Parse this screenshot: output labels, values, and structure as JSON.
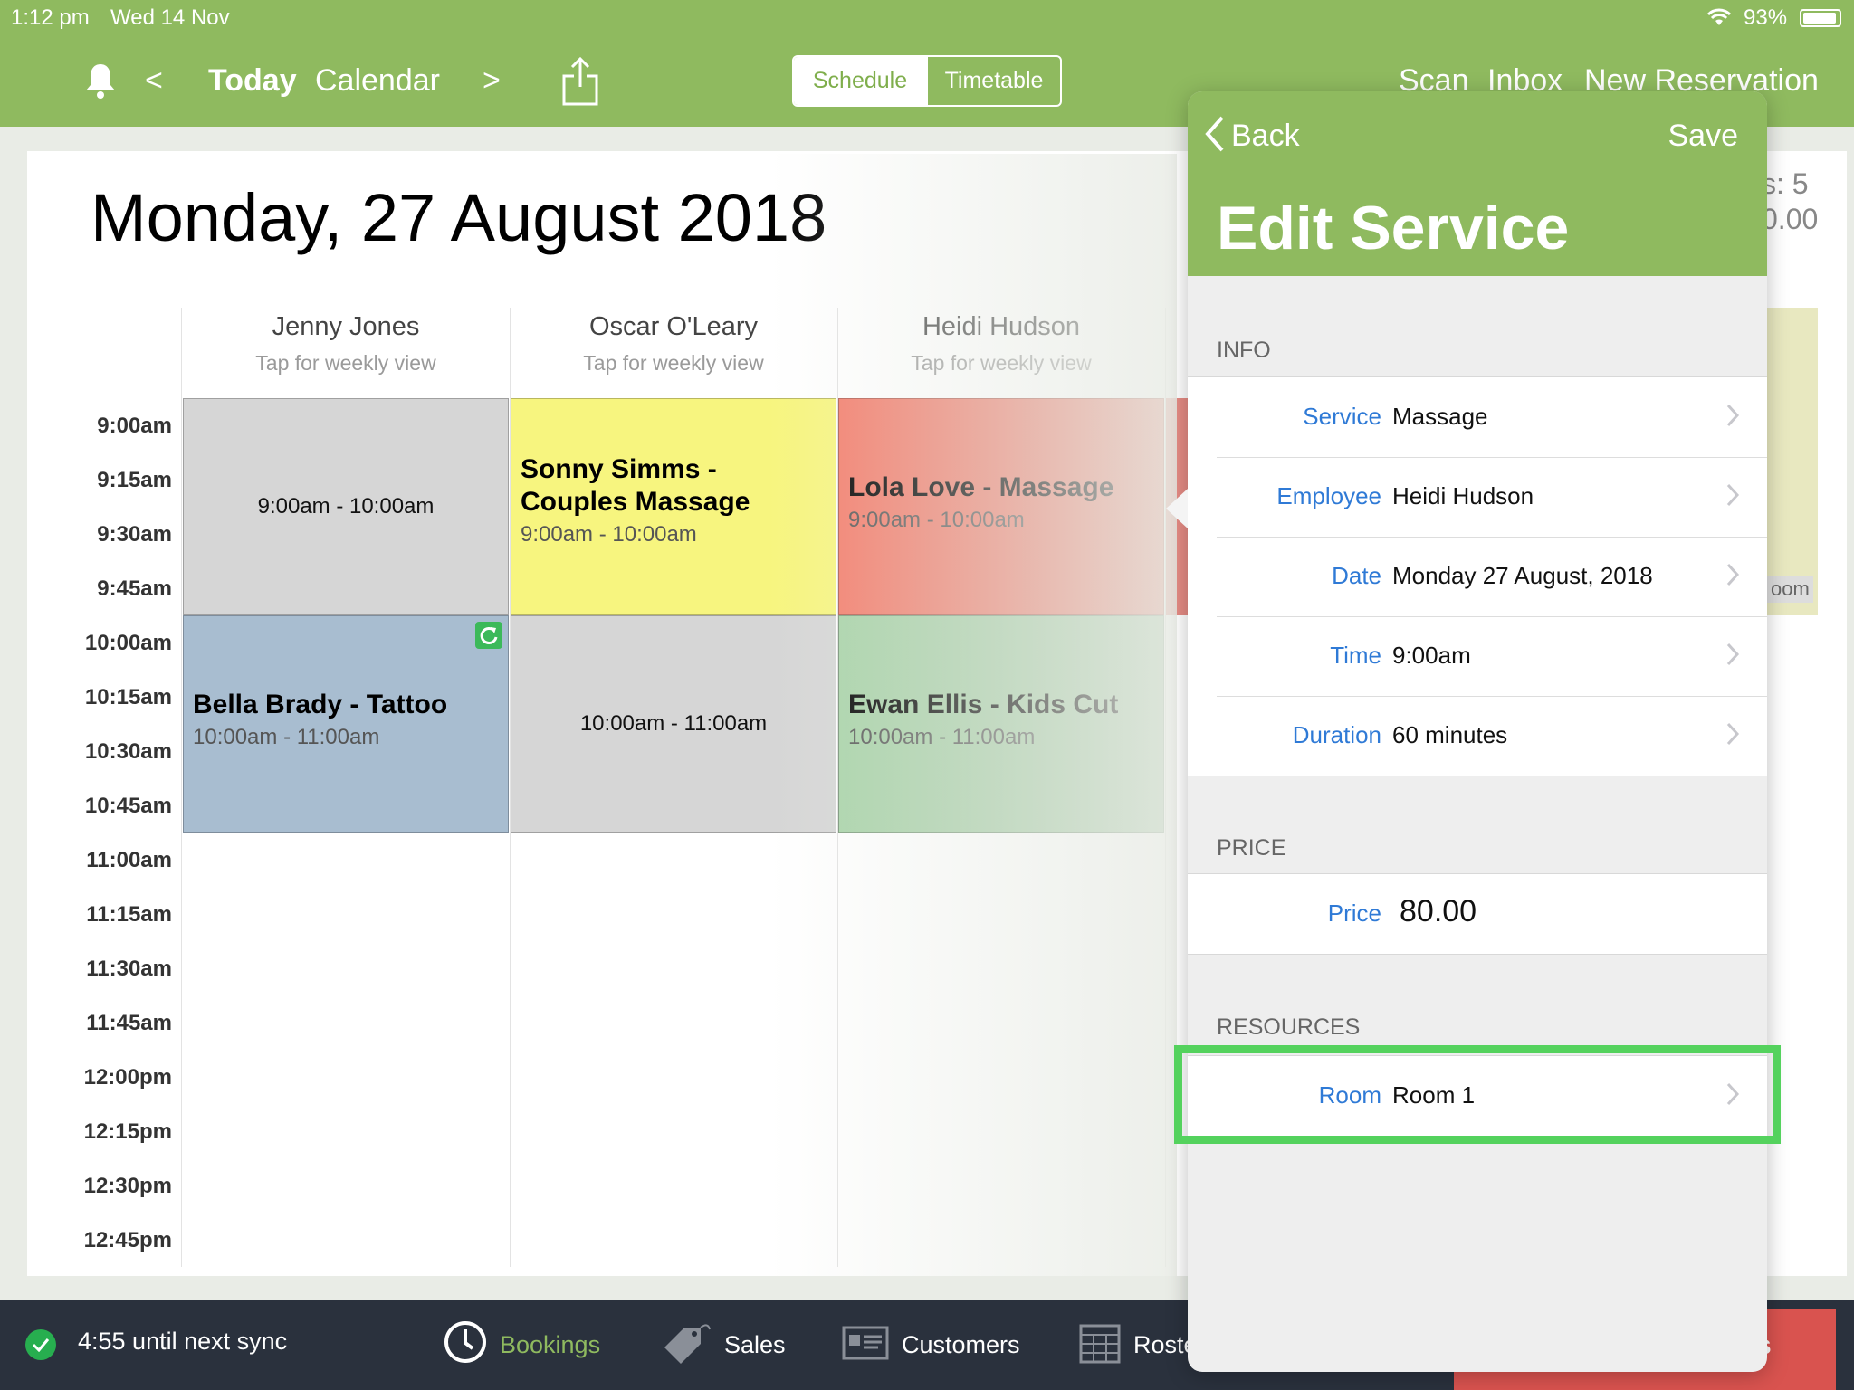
{
  "status_bar": {
    "time": "1:12 pm",
    "date": "Wed 14 Nov",
    "battery": "93%"
  },
  "header": {
    "prev": "<",
    "today": "Today",
    "calendar": "Calendar",
    "next": ">",
    "segments": [
      "Schedule",
      "Timetable"
    ],
    "scan": "Scan",
    "inbox": "Inbox",
    "new_reservation": "New Reservation"
  },
  "calendar": {
    "date_title": "Monday, 27 August 2018",
    "columns": [
      {
        "name": "Jenny Jones",
        "sub": "Tap for weekly view"
      },
      {
        "name": "Oscar O'Leary",
        "sub": "Tap for weekly view"
      },
      {
        "name": "Heidi Hudson",
        "sub": "Tap for weekly view"
      }
    ],
    "time_labels": [
      "9:00am",
      "9:15am",
      "9:30am",
      "9:45am",
      "10:00am",
      "10:15am",
      "10:30am",
      "10:45am",
      "11:00am",
      "11:15am",
      "11:30am",
      "11:45am",
      "12:00pm",
      "12:15pm",
      "12:30pm",
      "12:45pm"
    ],
    "appointments": [
      {
        "title": "",
        "time": "9:00am - 10:00am",
        "color": "#d6d6d6"
      },
      {
        "title": "Sonny Simms - Couples Massage",
        "time": "9:00am - 10:00am",
        "color": "#f7f57f"
      },
      {
        "title": "Lola Love - Massage",
        "time": "9:00am - 10:00am",
        "color": "#f47d6c"
      },
      {
        "title": "Bella Brady - Tattoo",
        "time": "10:00am - 11:00am",
        "color": "#a8bdd0"
      },
      {
        "title": "",
        "time": "10:00am - 11:00am",
        "color": "#d6d6d6"
      },
      {
        "title": "Ewan Ellis - Kids Cut",
        "time": "10:00am - 11:00am",
        "color": "#a8d3a8"
      }
    ],
    "peek_text_1": "s: 5",
    "peek_text_2": "0.00",
    "peek_room": "oom"
  },
  "panel": {
    "back": "Back",
    "save": "Save",
    "title": "Edit Service",
    "info_label": "INFO",
    "info_rows": [
      {
        "label": "Service",
        "value": "Massage"
      },
      {
        "label": "Employee",
        "value": "Heidi Hudson"
      },
      {
        "label": "Date",
        "value": "Monday 27 August, 2018"
      },
      {
        "label": "Time",
        "value": "9:00am"
      },
      {
        "label": "Duration",
        "value": "60 minutes"
      }
    ],
    "price_label": "PRICE",
    "price": {
      "label": "Price",
      "value": "80.00"
    },
    "resources_label": "RESOURCES",
    "room": {
      "label": "Room",
      "value": "Room 1"
    }
  },
  "tabbar": {
    "sync": "4:55 until next sync",
    "tabs": [
      "Bookings",
      "Sales",
      "Customers",
      "Roste"
    ],
    "active_color": "#8fba5f",
    "red_button_text": "ts"
  }
}
